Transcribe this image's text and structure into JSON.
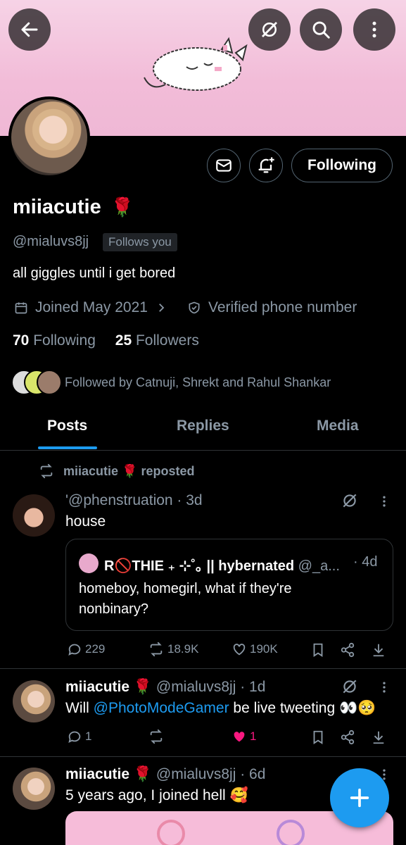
{
  "profile": {
    "display_name": "miiacutie",
    "name_emoji": "🌹",
    "handle": "@mialuvs8jj",
    "follows_you": "Follows you",
    "bio": "all giggles until i get bored",
    "joined": "Joined May 2021",
    "verified": "Verified phone number",
    "following_count": "70",
    "following_label": "Following",
    "followers_count": "25",
    "followers_label": "Followers",
    "followed_by": "Followed by Catnuji, Shrekt and Rahul Shankar",
    "follow_button": "Following"
  },
  "tabs": [
    "Posts",
    "Replies",
    "Media"
  ],
  "posts": [
    {
      "repost_label": "miiacutie 🌹 reposted",
      "author": "'@phenstruation · 3d",
      "text": "house",
      "quote": {
        "author_name": "R🚫THIE ₊ ⊹˚｡ || hybernated",
        "author_handle": "@_a...",
        "time": "· 4d",
        "text": "homeboy, homegirl, what if they're nonbinary?"
      },
      "replies": "229",
      "reposts": "18.9K",
      "likes": "190K"
    },
    {
      "author_name": "miiacutie 🌹",
      "author_handle": "@mialuvs8jj · 1d",
      "text_prefix": "Will ",
      "mention": "@PhotoModeGamer",
      "text_suffix": " be live tweeting 👀🥺",
      "replies": "1",
      "reposts": "",
      "likes": "1"
    },
    {
      "author_name": "miiacutie 🌹",
      "author_handle": "@mialuvs8jj · 6d",
      "text": "5 years ago, I joined hell 🥰"
    }
  ],
  "colors": {
    "accent": "#1d9bf0",
    "like": "#f91880",
    "banner": "#f2bcd8"
  }
}
